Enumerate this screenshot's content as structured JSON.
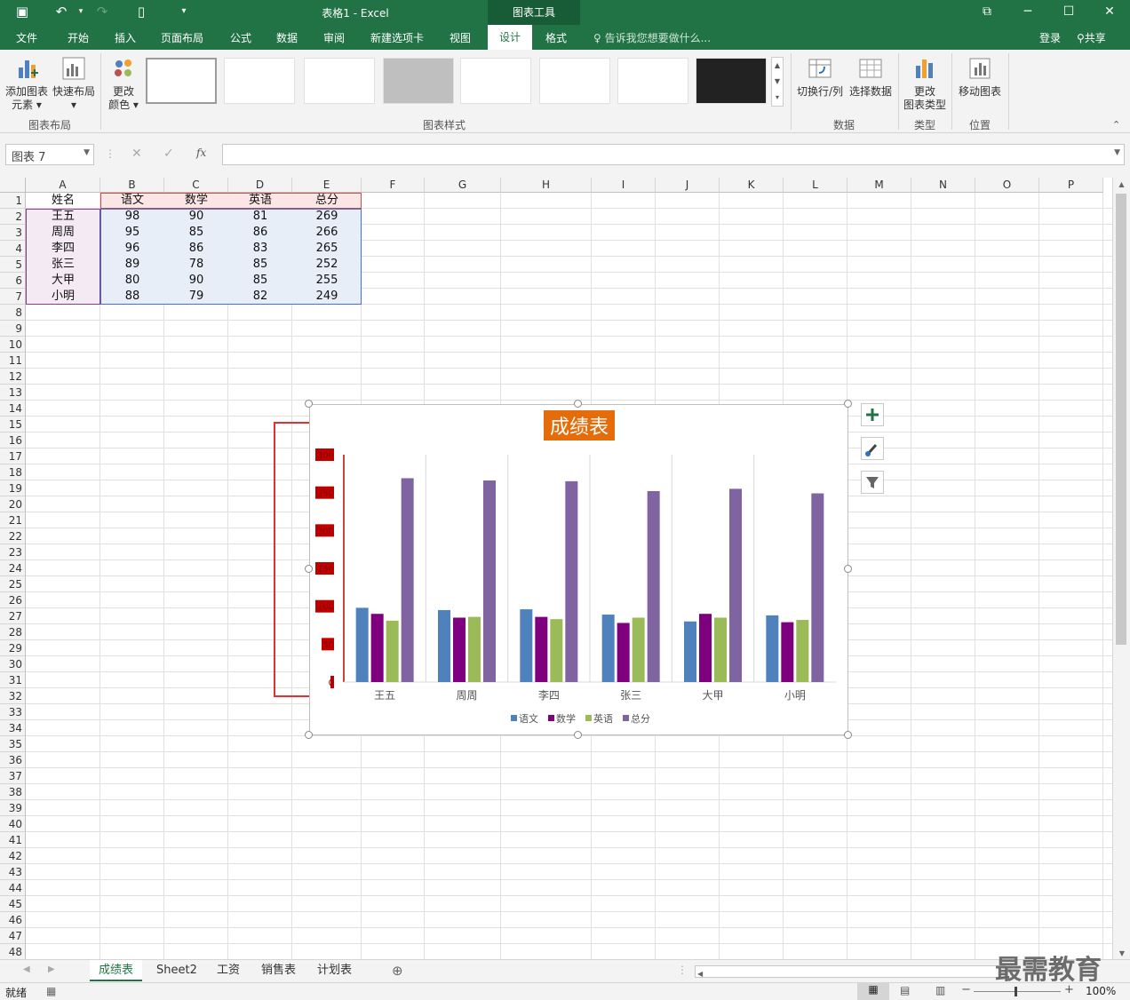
{
  "titlebar": {
    "title": "表格1 - Excel",
    "context_tools": "图表工具"
  },
  "tabs": [
    "文件",
    "开始",
    "插入",
    "页面布局",
    "公式",
    "数据",
    "审阅",
    "新建选项卡",
    "视图",
    "设计",
    "格式"
  ],
  "active_tab": "设计",
  "tellme": "告诉我您想要做什么...",
  "account": {
    "signin": "登录",
    "share": "共享"
  },
  "ribbon": {
    "add_element": [
      "添加图表",
      "元素"
    ],
    "quick_layout": "快速布局",
    "change_color": [
      "更改",
      "颜色"
    ],
    "group_layout": "图表布局",
    "group_styles": "图表样式",
    "switch_row_col": "切换行/列",
    "select_data": "选择数据",
    "group_data": "数据",
    "change_type": [
      "更改",
      "图表类型"
    ],
    "group_type": "类型",
    "move_chart": "移动图表",
    "group_location": "位置"
  },
  "formula": {
    "namebox": "图表 7",
    "fx": "fx",
    "content": ""
  },
  "columns": [
    "A",
    "B",
    "C",
    "D",
    "E",
    "F",
    "G",
    "H",
    "I",
    "J",
    "K",
    "L",
    "M",
    "N",
    "O",
    "P"
  ],
  "row_count": 48,
  "table": {
    "headers": [
      "姓名",
      "语文",
      "数学",
      "英语",
      "总分"
    ],
    "rows": [
      [
        "王五",
        "98",
        "90",
        "81",
        "269"
      ],
      [
        "周周",
        "95",
        "85",
        "86",
        "266"
      ],
      [
        "李四",
        "96",
        "86",
        "83",
        "265"
      ],
      [
        "张三",
        "89",
        "78",
        "85",
        "252"
      ],
      [
        "大甲",
        "80",
        "90",
        "85",
        "255"
      ],
      [
        "小明",
        "88",
        "79",
        "82",
        "249"
      ]
    ]
  },
  "chart_data": {
    "type": "bar",
    "title": "成绩表",
    "categories": [
      "王五",
      "周周",
      "李四",
      "张三",
      "大甲",
      "小明"
    ],
    "series": [
      {
        "name": "语文",
        "values": [
          98,
          95,
          96,
          89,
          80,
          88
        ],
        "color": "#4f81bd"
      },
      {
        "name": "数学",
        "values": [
          90,
          85,
          86,
          78,
          90,
          79
        ],
        "color": "#7f007f"
      },
      {
        "name": "英语",
        "values": [
          81,
          86,
          83,
          85,
          85,
          82
        ],
        "color": "#9bbb59"
      },
      {
        "name": "总分",
        "values": [
          269,
          266,
          265,
          252,
          255,
          249
        ],
        "color": "#8064a2"
      }
    ],
    "ylim": [
      0,
      300
    ],
    "legend": "bottom",
    "grid": "vertical"
  },
  "colors": {
    "excel_green": "#217346",
    "title_bg": "#e46c0a",
    "highlight": "#e03030",
    "axis_label_fill": "#c00000"
  },
  "sheets": [
    "成绩表",
    "Sheet2",
    "工资",
    "销售表",
    "计划表"
  ],
  "active_sheet": "成绩表",
  "status": {
    "ready": "就绪",
    "zoom": "100%"
  },
  "watermark": "最需教育"
}
